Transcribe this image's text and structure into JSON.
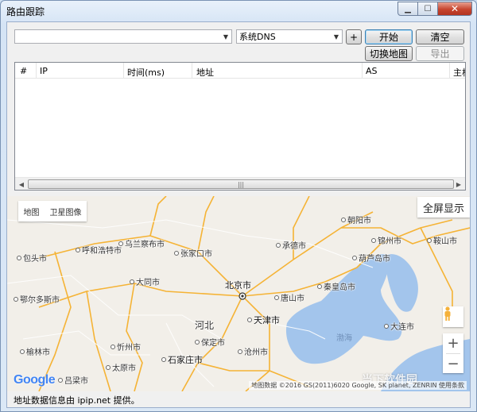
{
  "window": {
    "title": "路由跟踪"
  },
  "toolbar": {
    "address_value": "",
    "dns_selected": "系统DNS",
    "add_label": "+",
    "start_label": "开始",
    "clear_label": "清空",
    "toggle_map_label": "切换地图",
    "export_label": "导出"
  },
  "table": {
    "columns": [
      "#",
      "IP",
      "时间(ms)",
      "地址",
      "AS",
      "主机"
    ],
    "rows": []
  },
  "map": {
    "type_map": "地图",
    "type_satellite": "卫星图像",
    "fullscreen": "全屏显示",
    "zoom_in": "+",
    "zoom_out": "−",
    "logo": "Google",
    "attribution": "地图数据 ©2016 GS(2011)6020 Google, SK planet, ZENRIN  使用条款",
    "sea": "渤海",
    "cities": [
      "朝阳市",
      "锦州市",
      "鞍山市",
      "乌兰察布市",
      "呼和浩特市",
      "包头市",
      "张家口市",
      "承德市",
      "葫芦岛市",
      "大同市",
      "北京市",
      "秦皇岛市",
      "鄂尔多斯市",
      "唐山市",
      "河北",
      "天津市",
      "大连市",
      "保定市",
      "忻州市",
      "榆林市",
      "沧州市",
      "石家庄市",
      "太原市",
      "吕梁市"
    ]
  },
  "watermark": "当下软件园",
  "status": "地址数据信息由 ipip.net 提供。"
}
